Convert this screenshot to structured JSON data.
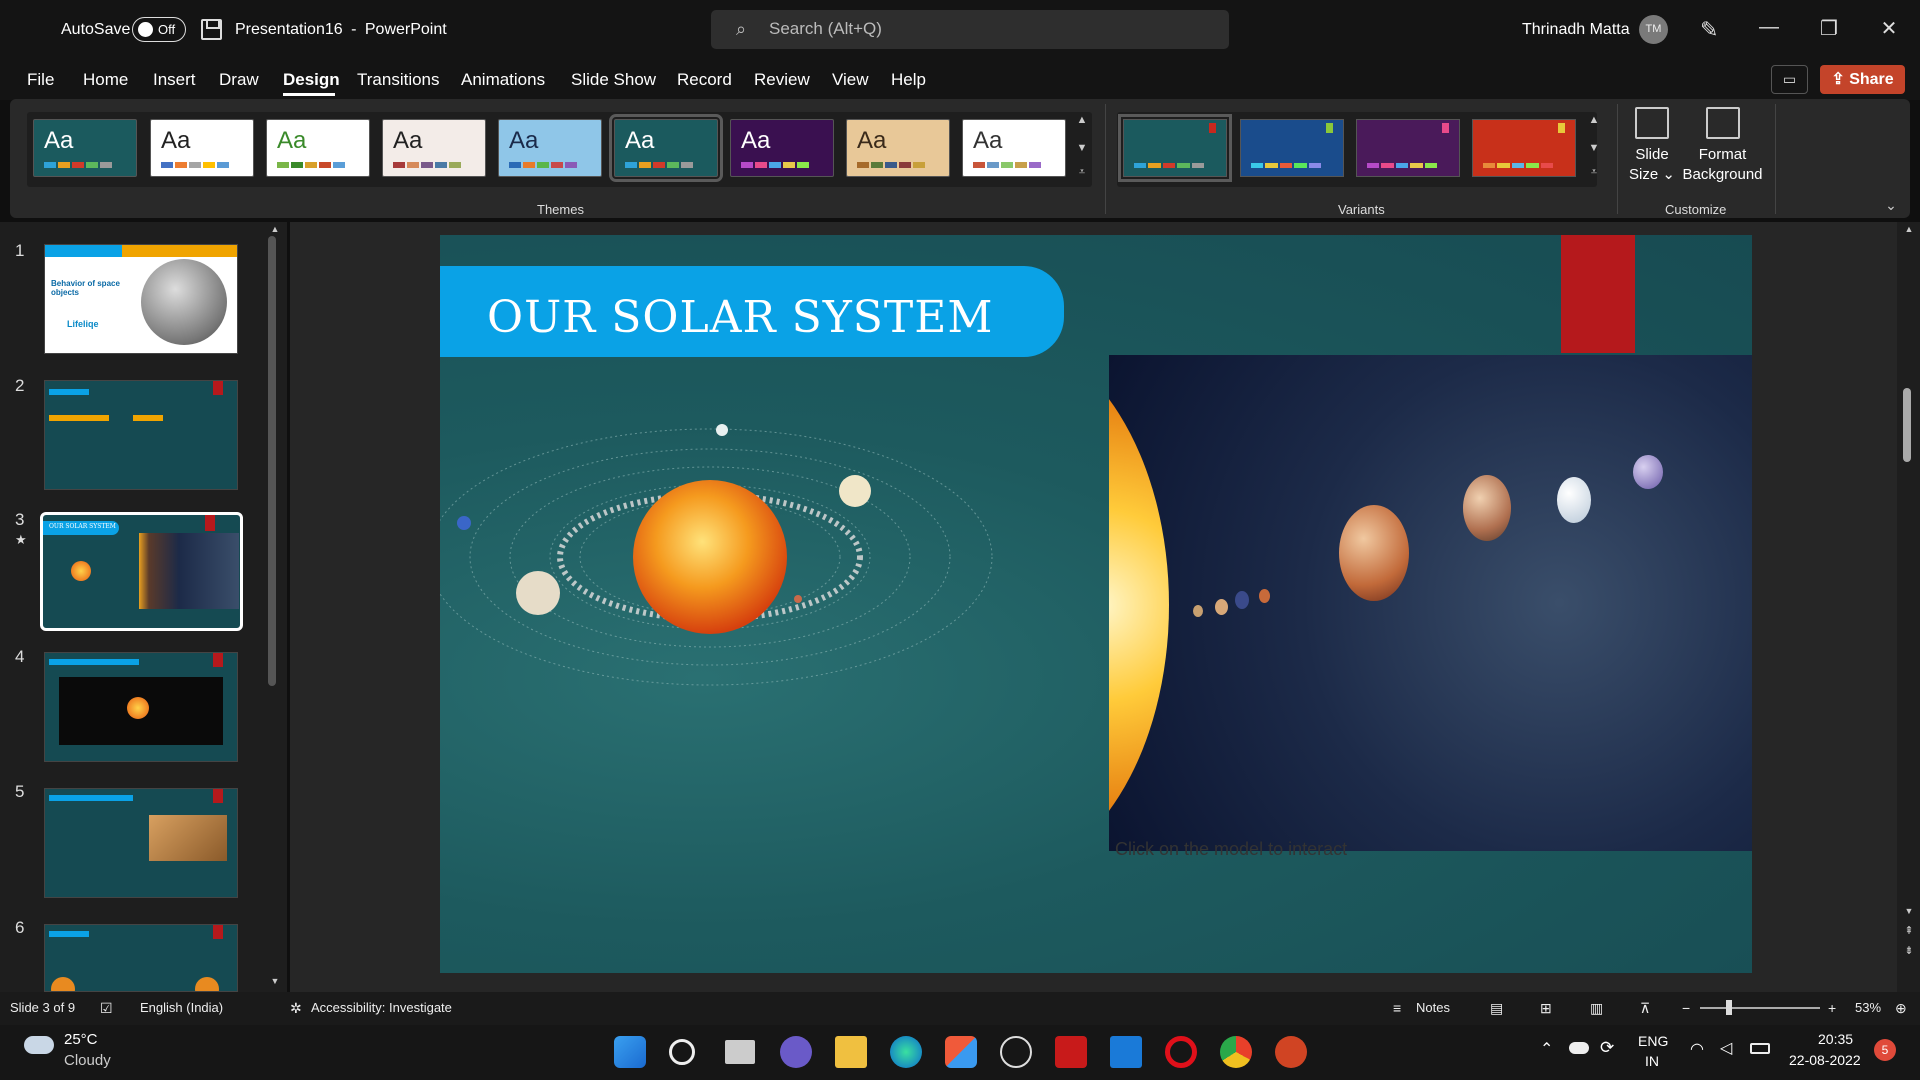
{
  "app": {
    "name": "PowerPoint",
    "document": "Presentation16",
    "title_separator": "-"
  },
  "titlebar": {
    "autosave_label": "AutoSave",
    "autosave_state": "Off",
    "search_placeholder": "Search (Alt+Q)",
    "user_name": "Thrinadh Matta",
    "user_initials": "TM"
  },
  "menu": {
    "items": [
      "File",
      "Home",
      "Insert",
      "Draw",
      "Design",
      "Transitions",
      "Animations",
      "Slide Show",
      "Record",
      "Review",
      "View",
      "Help"
    ],
    "active": "Design",
    "share_label": "Share"
  },
  "ribbon": {
    "themes_label": "Themes",
    "variants_label": "Variants",
    "customize_label": "Customize",
    "theme_aa": "Aa",
    "slide_size_label": "Slide\nSize",
    "slide_size_line1": "Slide",
    "slide_size_line2": "Size ⌄",
    "format_bg_line1": "Format",
    "format_bg_line2": "Background",
    "themes": [
      {
        "bg": "#1b5a5e",
        "fg": "#ffffff",
        "colors": [
          "#2ea3d8",
          "#e8a020",
          "#d23a2a",
          "#5cb85c",
          "#9a9a9a"
        ]
      },
      {
        "bg": "#ffffff",
        "fg": "#222222",
        "colors": [
          "#4472c4",
          "#ed7d31",
          "#a5a5a5",
          "#ffc000",
          "#5b9bd5"
        ]
      },
      {
        "bg": "#ffffff",
        "fg": "#3a8a2a",
        "colors": [
          "#7ab648",
          "#3a8a2a",
          "#d9a02a",
          "#c94a2a",
          "#5a9ed8"
        ]
      },
      {
        "bg": "#f3ece8",
        "fg": "#222222",
        "colors": [
          "#a63a3a",
          "#d68a5a",
          "#7a5a8a",
          "#4a7aa6",
          "#9aaa5a"
        ]
      },
      {
        "bg": "#8fc6e8",
        "fg": "#1a2a4a",
        "colors": [
          "#2a6ab6",
          "#e87a2a",
          "#5ab64a",
          "#c84a4a",
          "#8a5ab6"
        ]
      },
      {
        "bg": "#1b5a5e",
        "fg": "#ffffff",
        "colors": [
          "#2ea3d8",
          "#e8a020",
          "#d23a2a",
          "#5cb85c",
          "#9a9a9a"
        ]
      },
      {
        "bg": "#3a1050",
        "fg": "#ffffff",
        "colors": [
          "#b64ac8",
          "#e84a8a",
          "#4aa6e8",
          "#e8c84a",
          "#8ae84a"
        ]
      },
      {
        "bg": "#e8c898",
        "fg": "#3a2a1a",
        "colors": [
          "#a66a2a",
          "#5a7a3a",
          "#3a5a8a",
          "#8a3a3a",
          "#c8a03a"
        ]
      },
      {
        "bg": "#ffffff",
        "fg": "#333333",
        "colors": [
          "#c8553a",
          "#6a9ac8",
          "#8ac86a",
          "#c8a04a",
          "#9a6ac8"
        ]
      }
    ],
    "variants": [
      {
        "bg": "#1b5a5e",
        "flag": "#c8281e",
        "colors": [
          "#2ea3d8",
          "#e8a020",
          "#d23a2a",
          "#5cb85c",
          "#9a9a9a"
        ]
      },
      {
        "bg": "#1a4c8c",
        "flag": "#8ac83a",
        "colors": [
          "#3ac8e8",
          "#e8c83a",
          "#e85a3a",
          "#5ae85a",
          "#8a8ae8"
        ]
      },
      {
        "bg": "#4a1a5a",
        "flag": "#e84a8a",
        "colors": [
          "#b64ac8",
          "#e84a8a",
          "#4aa6e8",
          "#e8c84a",
          "#8ae84a"
        ]
      },
      {
        "bg": "#c8301a",
        "flag": "#e8c83a",
        "colors": [
          "#e88a3a",
          "#e8c83a",
          "#5ab6e8",
          "#8ae84a",
          "#e84a4a"
        ]
      }
    ]
  },
  "thumbnails": [
    {
      "num": "1",
      "title": "Behavior of space objects",
      "brand": "Lifeliqe"
    },
    {
      "num": "2"
    },
    {
      "num": "3",
      "title": "OUR SOLAR SYSTEM",
      "star": "★"
    },
    {
      "num": "4"
    },
    {
      "num": "5"
    },
    {
      "num": "6"
    }
  ],
  "slide": {
    "title": "OUR SOLAR SYSTEM",
    "caption": "Click on the model to interact"
  },
  "status": {
    "slide_position": "Slide 3 of 9",
    "language": "English (India)",
    "accessibility": "Accessibility: Investigate",
    "notes": "Notes",
    "zoom": "53%"
  },
  "taskbar": {
    "weather_temp": "25°C",
    "weather_desc": "Cloudy",
    "lang_line1": "ENG",
    "lang_line2": "IN",
    "time": "20:35",
    "date": "22-08-2022",
    "notifications": "5"
  }
}
